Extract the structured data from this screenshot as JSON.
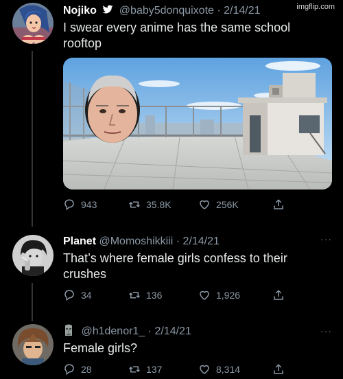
{
  "watermark": "imgflip.com",
  "tweets": [
    {
      "name": "Nojiko",
      "handle": "@baby5donquixote",
      "separator": "·",
      "date": "2/14/21",
      "text": "I swear every anime has the same school rooftop",
      "stats": {
        "replies": "943",
        "retweets": "35.8K",
        "likes": "256K"
      }
    },
    {
      "name": "Planet",
      "handle": "@Momoshikkiii",
      "separator": "·",
      "date": "2/14/21",
      "text": "That’s where female girls confess to their crushes",
      "stats": {
        "replies": "34",
        "retweets": "136",
        "likes": "1,926"
      }
    },
    {
      "name": "",
      "handle": "@h1denor1_",
      "separator": "·",
      "date": "2/14/21",
      "text": "Female girls?",
      "stats": {
        "replies": "28",
        "retweets": "137",
        "likes": "8,314"
      }
    }
  ],
  "more_menu": "···",
  "icons": {
    "reply": "reply-icon",
    "retweet": "retweet-icon",
    "like": "heart-icon",
    "share": "share-icon",
    "verified": "twitter-bird-icon",
    "moai": "moai-icon"
  }
}
